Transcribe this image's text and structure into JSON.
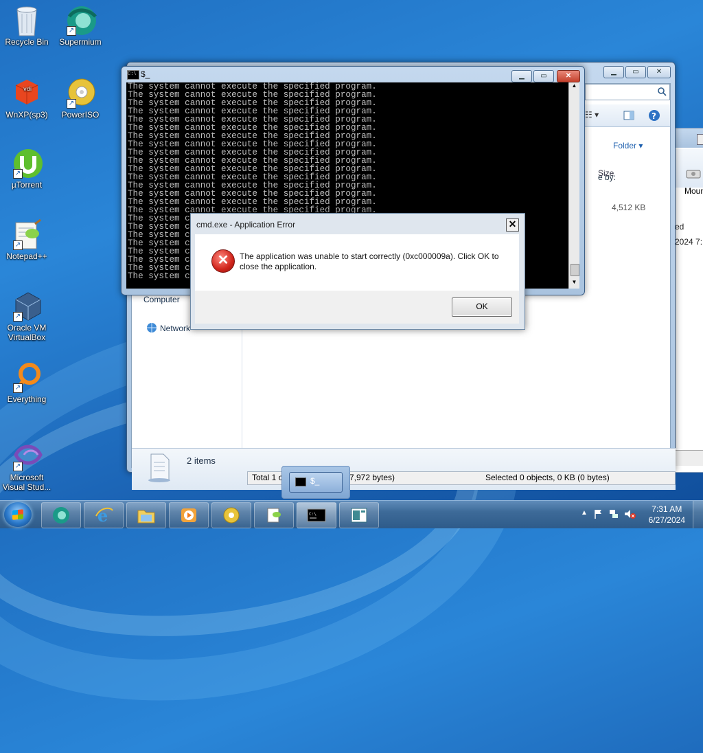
{
  "desktop": {
    "icons": [
      {
        "label": "Recycle Bin",
        "icon": "recycle-bin-icon"
      },
      {
        "label": "Supermium",
        "icon": "supermium-icon"
      },
      {
        "label": "WnXP(sp3)",
        "icon": "vdi-icon"
      },
      {
        "label": "PowerISO",
        "icon": "poweriso-icon"
      },
      {
        "label": "µTorrent",
        "icon": "utorrent-icon"
      },
      {
        "label": "Notepad++",
        "icon": "notepadpp-icon"
      },
      {
        "label": "Oracle VM VirtualBox",
        "icon": "virtualbox-icon"
      },
      {
        "label": "Everything",
        "icon": "everything-icon"
      },
      {
        "label": "Microsoft Visual Stud...",
        "icon": "visual-studio-icon"
      }
    ]
  },
  "explorer": {
    "arrange_by": "Folder",
    "arrange_prefix": "e by:",
    "col_size": "Size",
    "file_size": "4,512 KB",
    "nav_computer": "Computer",
    "nav_network": "Network",
    "item_count": "2 items",
    "status_left": "Total 1 o",
    "status_mid": "7,972 bytes)",
    "status_right": "Selected 0 objects, 0 KB (0 bytes)",
    "right_mount": "Moun",
    "right_text1": "ed",
    "right_text2": "2024 7:"
  },
  "cmd": {
    "title": "$_",
    "lines": [
      "The system cannot execute the specified program.",
      "The system cannot execute the specified program.",
      "The system cannot execute the specified program.",
      "The system cannot execute the specified program.",
      "The system cannot execute the specified program.",
      "The system cannot execute the specified program.",
      "The system cannot execute the specified program.",
      "The system cannot execute the specified program.",
      "The system cannot execute the specified program.",
      "The system cannot execute the specified program.",
      "The system cannot execute the specified program.",
      "The system cannot execute the specified program.",
      "The system cannot execute the specified program.",
      "The system cannot execute the specified program.",
      "The system cannot execute the specified program.",
      "The system cannot execute the specified program.",
      "The system cannot execute the specified program.",
      "The system cannot execute the specified program.",
      "The system cannot execute the specified program.",
      "The system cannot execute the specified program.",
      "The system cannot execute the specified program.",
      "The system cannot execute the specified program.",
      "The system cannot execute the specified program.",
      "The system cannot execute the specified program."
    ]
  },
  "dialog": {
    "title": "cmd.exe - Application Error",
    "message": "The application was unable to start correctly (0xc000009a). Click OK to close the application.",
    "ok_label": "OK",
    "close_glyph": "✕"
  },
  "taskbar": {
    "thumb_title": "$_",
    "time": "7:31 AM",
    "date": "6/27/2024"
  }
}
